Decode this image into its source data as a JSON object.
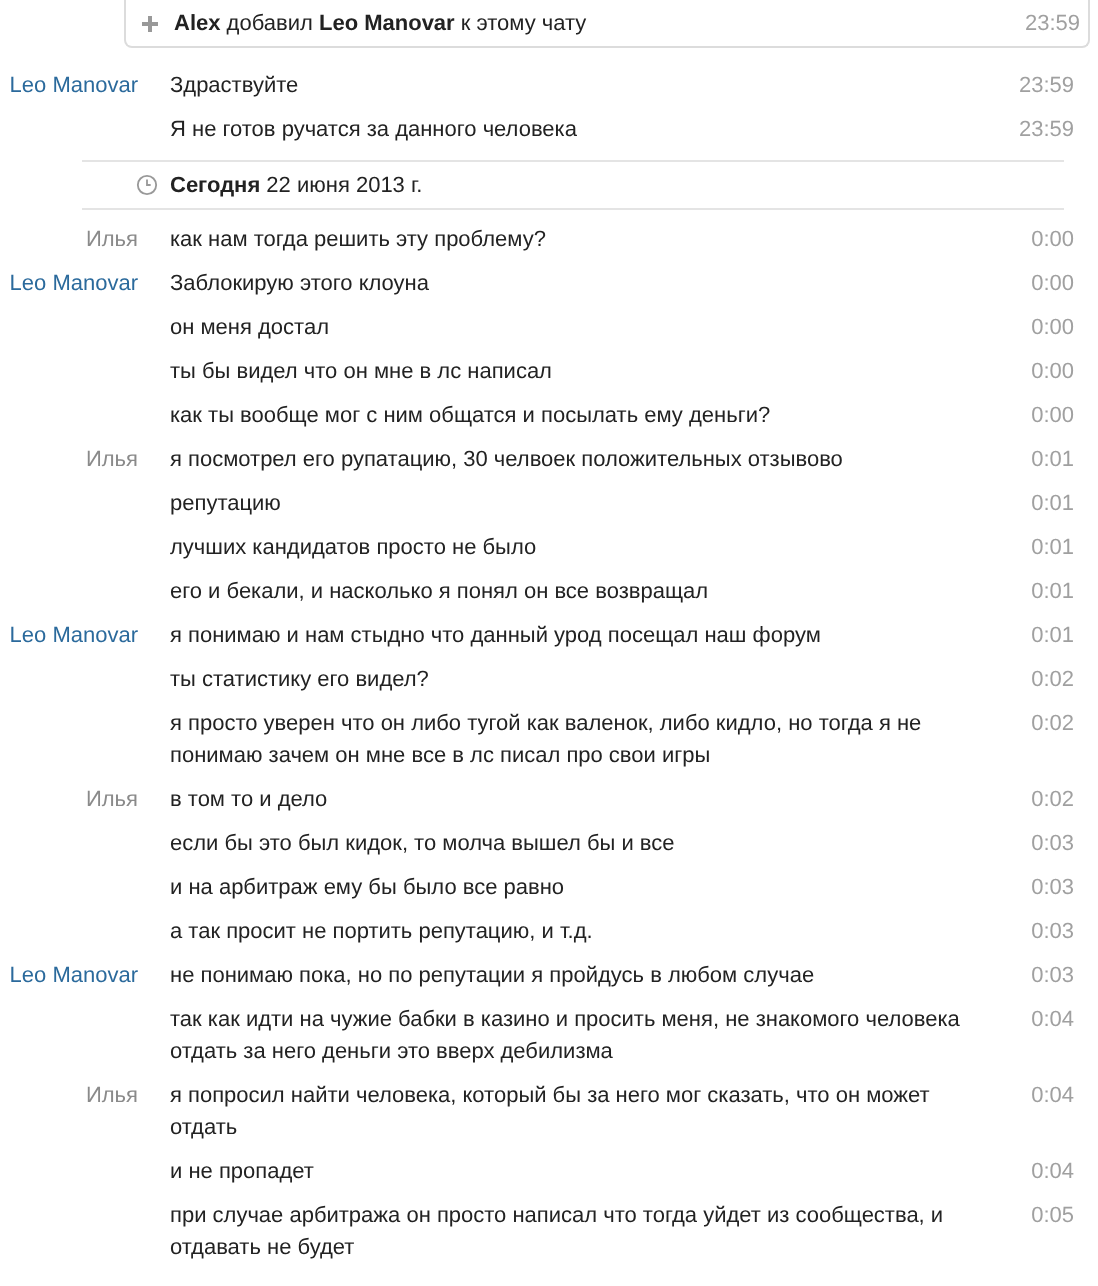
{
  "notice": {
    "text": "**Alex** добавил **Leo Manovar** к этому чату",
    "time": "23:59"
  },
  "early_messages": [
    {
      "sender": {
        "name": "Leo Manovar",
        "kind": "contact"
      },
      "text": "Здраствуйте",
      "time": "23:59"
    },
    {
      "text": "Я не готов ручатся за данного человека",
      "time": "23:59"
    }
  ],
  "date_separator": "**Сегодня** 22 июня 2013 г.",
  "messages": [
    {
      "sender": {
        "name": "Илья",
        "kind": "me"
      },
      "text": "как нам тогда решить эту проблему?",
      "time": "0:00"
    },
    {
      "sender": {
        "name": "Leo Manovar",
        "kind": "contact"
      },
      "text": "Заблокирую этого клоуна",
      "time": "0:00"
    },
    {
      "text": "он меня достал",
      "time": "0:00"
    },
    {
      "text": "ты бы видел что он мне в лс написал",
      "time": "0:00"
    },
    {
      "text": "как ты вообще мог с ним общатся и посылать ему деньги?",
      "time": "0:00"
    },
    {
      "sender": {
        "name": "Илья",
        "kind": "me"
      },
      "text": "я посмотрел его рупатацию, 30 челвоек положительных отзывово",
      "time": "0:01"
    },
    {
      "text": "репутацию",
      "time": "0:01"
    },
    {
      "text": "лучших кандидатов просто не было",
      "time": "0:01"
    },
    {
      "text": "его и бекали, и насколько я понял он все возвращал",
      "time": "0:01"
    },
    {
      "sender": {
        "name": "Leo Manovar",
        "kind": "contact"
      },
      "text": "я понимаю и нам стыдно что данный урод посещал наш форум",
      "time": "0:01"
    },
    {
      "text": "ты статистику его видел?",
      "time": "0:02"
    },
    {
      "text": "я просто уверен что он либо тугой как валенок, либо кидло, но тогда я не понимаю зачем он мне все в лс писал про свои игры",
      "time": "0:02"
    },
    {
      "sender": {
        "name": "Илья",
        "kind": "me"
      },
      "text": "в том то и дело",
      "time": "0:02"
    },
    {
      "text": "если бы это был кидок, то молча вышел бы и все",
      "time": "0:03"
    },
    {
      "text": "и на арбитраж ему бы было все равно",
      "time": "0:03"
    },
    {
      "text": "а так просит не портить репутацию, и т.д.",
      "time": "0:03"
    },
    {
      "sender": {
        "name": "Leo Manovar",
        "kind": "contact"
      },
      "text": "не понимаю пока, но по репутации я пройдусь в любом случае",
      "time": "0:03"
    },
    {
      "text": "так как идти на чужие бабки в казино и просить меня, не знакомого человека отдать за него деньги это вверх дебилизма",
      "time": "0:04"
    },
    {
      "sender": {
        "name": "Илья",
        "kind": "me"
      },
      "text": "я попросил найти человека, который бы за него мог сказать, что он может отдать",
      "time": "0:04"
    },
    {
      "text": "и не пропадет",
      "time": "0:04"
    },
    {
      "text": "при случае арбитража он просто написал что тогда уйдет из сообщества, и отдавать не будет",
      "time": "0:05"
    }
  ]
}
